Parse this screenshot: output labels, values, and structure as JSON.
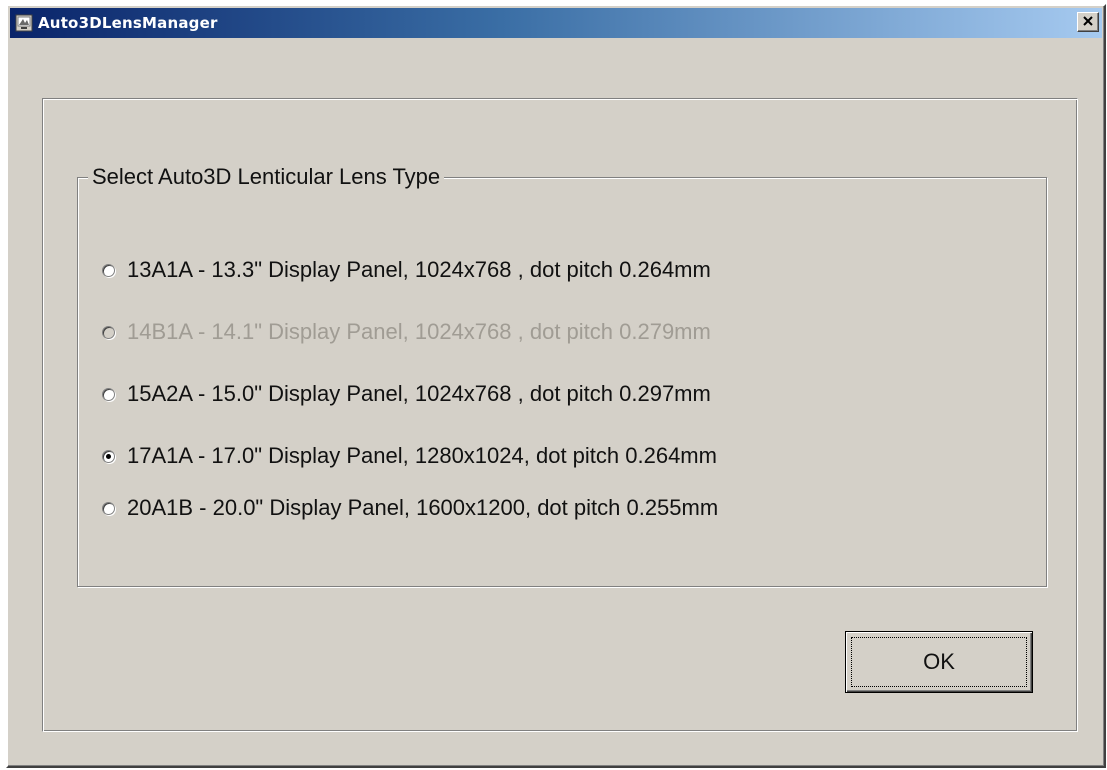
{
  "window": {
    "title": "Auto3DLensManager",
    "close_symbol": "×",
    "icons": {
      "app": "app-window-icon",
      "close": "close-icon"
    }
  },
  "group": {
    "legend": "Select Auto3D Lenticular Lens Type"
  },
  "lens_options": [
    {
      "label": "13A1A  - 13.3\" Display Panel, 1024x768 , dot pitch 0.264mm",
      "checked": false,
      "enabled": true
    },
    {
      "label": "14B1A  - 14.1\" Display Panel, 1024x768 , dot pitch 0.279mm",
      "checked": false,
      "enabled": false
    },
    {
      "label": "15A2A  - 15.0\" Display Panel, 1024x768 , dot pitch 0.297mm",
      "checked": false,
      "enabled": true
    },
    {
      "label": "17A1A  - 17.0\" Display Panel, 1280x1024, dot pitch 0.264mm",
      "checked": true,
      "enabled": true
    },
    {
      "label": "20A1B  - 20.0\" Display Panel, 1600x1200, dot pitch 0.255mm",
      "checked": false,
      "enabled": true
    }
  ],
  "buttons": {
    "ok_label": "OK"
  },
  "colors": {
    "title_gradient_start": "#0a246a",
    "title_gradient_end": "#a6caf0",
    "face": "#d4d0c8",
    "disabled_text": "#a09c94"
  }
}
